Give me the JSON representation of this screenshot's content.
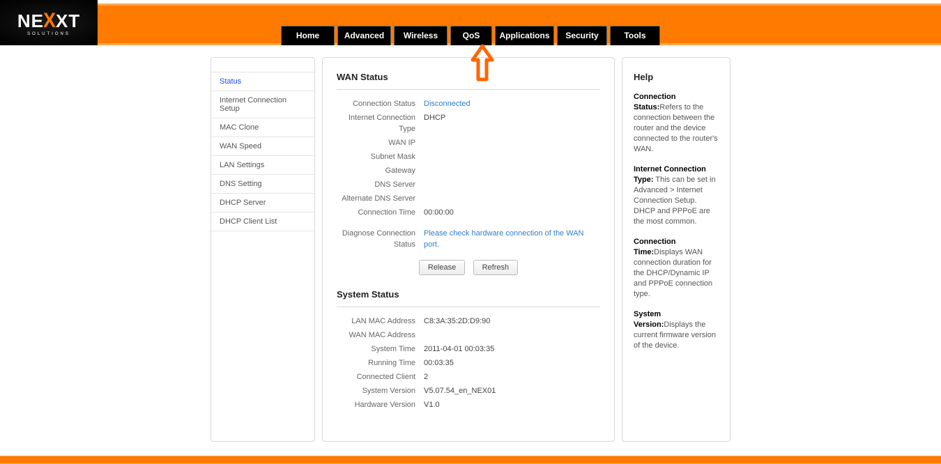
{
  "brand": {
    "name_left": "NE",
    "x": "X",
    "name_right": "XT",
    "subtitle": "SOLUTIONS"
  },
  "nav": {
    "home": "Home",
    "advanced": "Advanced",
    "wireless": "Wireless",
    "qos": "QoS",
    "applications": "Applications",
    "security": "Security",
    "tools": "Tools"
  },
  "sidebar": {
    "items": [
      {
        "label": "Status",
        "active": true
      },
      {
        "label": "Internet Connection Setup"
      },
      {
        "label": "MAC Clone"
      },
      {
        "label": "WAN Speed"
      },
      {
        "label": "LAN Settings"
      },
      {
        "label": "DNS Setting"
      },
      {
        "label": "DHCP Server"
      },
      {
        "label": "DHCP Client List"
      }
    ]
  },
  "wan": {
    "title": "WAN Status",
    "rows": {
      "conn_status_k": "Connection Status",
      "conn_status_v": "Disconnected",
      "conn_type_k": "Internet Connection Type",
      "conn_type_v": "DHCP",
      "wan_ip_k": "WAN IP",
      "wan_ip_v": "",
      "subnet_k": "Subnet Mask",
      "subnet_v": "",
      "gateway_k": "Gateway",
      "gateway_v": "",
      "dns_k": "DNS Server",
      "dns_v": "",
      "altdns_k": "Alternate DNS Server",
      "altdns_v": "",
      "conntime_k": "Connection Time",
      "conntime_v": "00:00:00",
      "diag_k": "Diagnose Connection Status",
      "diag_v": "Please check hardware connection of the WAN port."
    },
    "btn_release": "Release",
    "btn_refresh": "Refresh"
  },
  "sys": {
    "title": "System Status",
    "rows": {
      "lanmac_k": "LAN MAC Address",
      "lanmac_v": "C8:3A:35:2D:D9:90",
      "wanmac_k": "WAN MAC Address",
      "wanmac_v": "",
      "systime_k": "System Time",
      "systime_v": "2011-04-01 00:03:35",
      "runtime_k": "Running Time",
      "runtime_v": "00:03:35",
      "clients_k": "Connected Client",
      "clients_v": "2",
      "sysver_k": "System Version",
      "sysver_v": "V5.07.54_en_NEX01",
      "hwver_k": "Hardware Version",
      "hwver_v": "V1.0"
    }
  },
  "help": {
    "title": "Help",
    "p1_b": "Connection Status:",
    "p1": "Refers to the connection between the router and the device connected to the router's WAN.",
    "p2_b": "Internet Connection Type:",
    "p2": " This can be set in Advanced > Internet Connection Setup. DHCP and PPPoE are the most common.",
    "p3_b": "Connection Time:",
    "p3": "Displays WAN connection duration for the DHCP/Dynamic IP and PPPoE connection type.",
    "p4_b": "System Version:",
    "p4": "Displays the current firmware version of the device."
  }
}
